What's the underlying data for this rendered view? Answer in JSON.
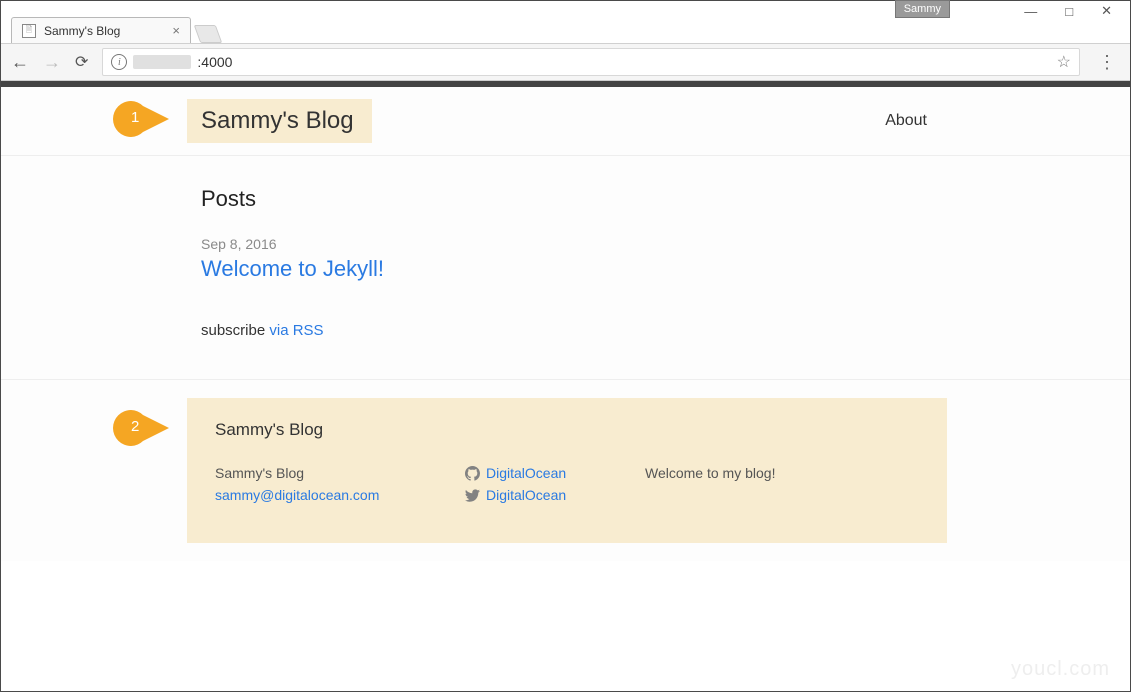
{
  "window": {
    "user_badge": "Sammy",
    "controls": {
      "min": "—",
      "max": "□",
      "close": "✕"
    }
  },
  "browser": {
    "tab_title": "Sammy's Blog",
    "url_port": ":4000"
  },
  "callouts": {
    "one": "1",
    "two": "2"
  },
  "header": {
    "site_title": "Sammy's Blog",
    "nav_about": "About"
  },
  "main": {
    "posts_heading": "Posts",
    "post": {
      "date": "Sep 8, 2016",
      "title": "Welcome to Jekyll!"
    },
    "subscribe_text": "subscribe ",
    "subscribe_link": "via RSS"
  },
  "footer": {
    "heading": "Sammy's Blog",
    "col1": {
      "name": "Sammy's Blog",
      "email": "sammy@digitalocean.com"
    },
    "col2": {
      "github": "DigitalOcean",
      "twitter": "DigitalOcean"
    },
    "col3": {
      "desc": "Welcome to my blog!"
    }
  },
  "watermark": "youcl.com"
}
